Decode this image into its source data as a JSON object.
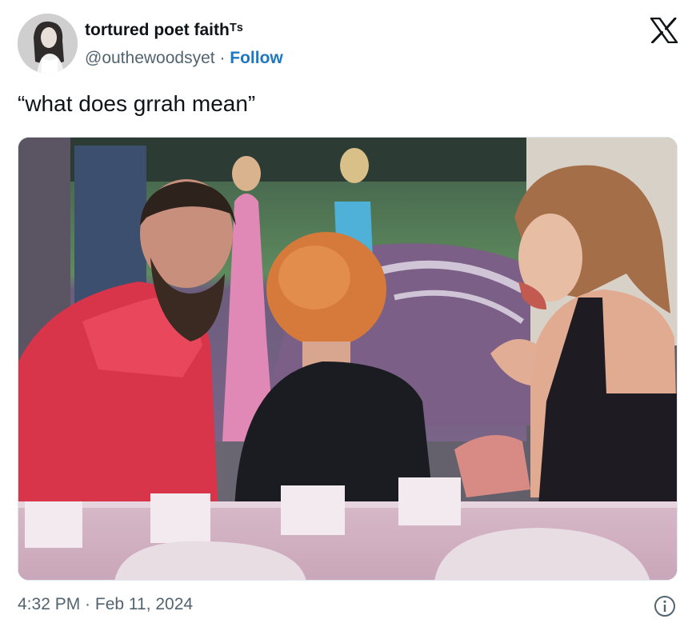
{
  "header": {
    "display_name": "tortured poet faithᵀˢ",
    "handle": "@outhewoodsyet",
    "separator": "·",
    "follow_label": "Follow",
    "avatar_icon": "avatar-photo",
    "brand_icon": "x-logo-icon"
  },
  "tweet": {
    "text": "“what does grrah mean”",
    "image_icon": "photo-attachment"
  },
  "footer": {
    "timestamp": "4:32 PM · Feb 11, 2024",
    "info_icon": "info-icon"
  },
  "colors": {
    "follow": "#1d77c2",
    "text_primary": "#0f1419",
    "text_secondary": "#536471"
  }
}
